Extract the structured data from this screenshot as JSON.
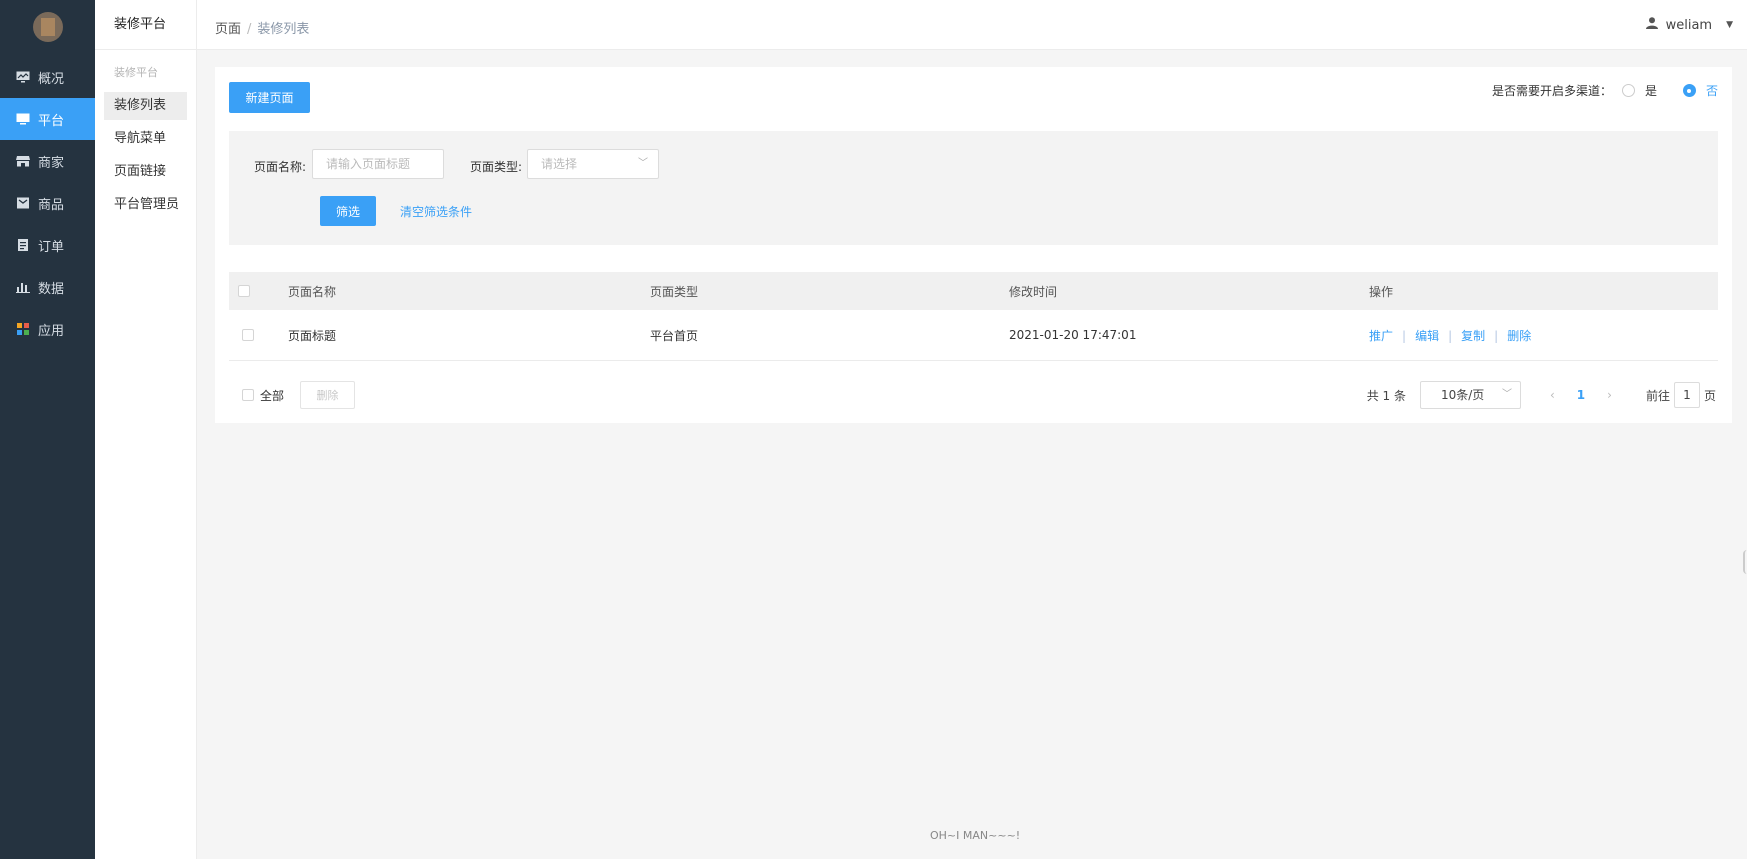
{
  "sidebar": {
    "items": [
      {
        "label": "概况",
        "icon": "monitor-icon"
      },
      {
        "label": "平台",
        "icon": "desktop-icon",
        "active": true
      },
      {
        "label": "商家",
        "icon": "store-icon"
      },
      {
        "label": "商品",
        "icon": "product-icon"
      },
      {
        "label": "订单",
        "icon": "order-icon"
      },
      {
        "label": "数据",
        "icon": "chart-icon"
      },
      {
        "label": "应用",
        "icon": "apps-icon"
      }
    ]
  },
  "subbar": {
    "title": "装修平台",
    "group": "装修平台",
    "items": [
      "装修列表",
      "导航菜单",
      "页面链接",
      "平台管理员"
    ]
  },
  "topbar": {
    "breadcrumb": [
      "页面",
      "装修列表"
    ],
    "username": "weliam"
  },
  "main": {
    "new_button": "新建页面",
    "channel_label": "是否需要开启多渠道：",
    "channel_options": [
      "是",
      "否"
    ],
    "channel_selected": "否",
    "filter": {
      "name_label": "页面名称:",
      "name_placeholder": "请输入页面标题",
      "type_label": "页面类型:",
      "type_placeholder": "请选择",
      "filter_button": "筛选",
      "clear_link": "清空筛选条件"
    },
    "table": {
      "headers": [
        "页面名称",
        "页面类型",
        "修改时间",
        "操作"
      ],
      "rows": [
        {
          "name": "页面标题",
          "type": "平台首页",
          "modified": "2021-01-20 17:47:01"
        }
      ],
      "actions": [
        "推广",
        "编辑",
        "复制",
        "删除"
      ]
    },
    "footer": {
      "select_all": "全部",
      "delete_button": "删除",
      "total": "共 1 条",
      "page_size": "10条/页",
      "current_page": "1",
      "goto_label": "前往",
      "goto_value": "1",
      "page_unit": "页"
    }
  },
  "copyright": "OH~I MAN~~~!",
  "colors": {
    "accent": "#3aa0f6",
    "sidebar_bg": "#253340"
  }
}
